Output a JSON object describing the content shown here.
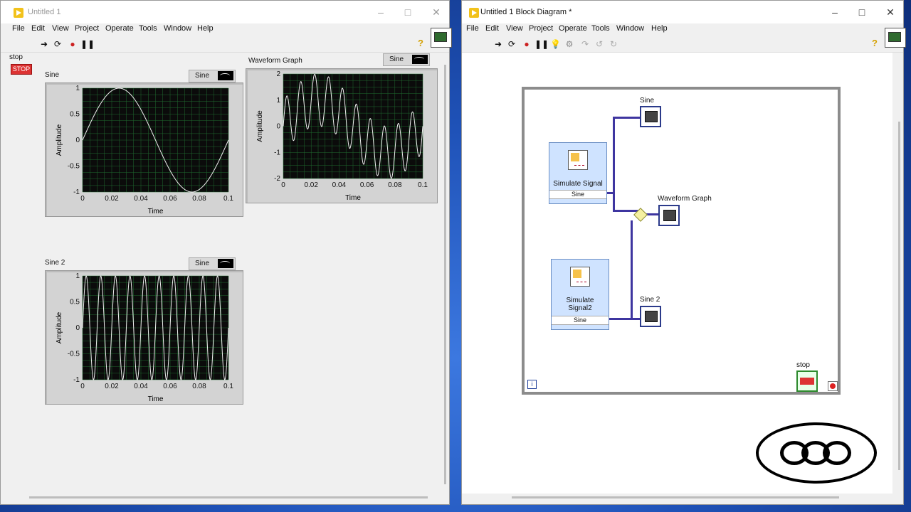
{
  "front_panel": {
    "title": "Untitled 1",
    "menu": [
      "File",
      "Edit",
      "View",
      "Project",
      "Operate",
      "Tools",
      "Window",
      "Help"
    ],
    "stop_label": "stop",
    "stop_button": "STOP",
    "controls": [
      "minimize",
      "maximize",
      "close"
    ]
  },
  "block_diagram": {
    "title": "Untitled 1 Block Diagram *",
    "menu": [
      "File",
      "Edit",
      "View",
      "Project",
      "Operate",
      "Tools",
      "Window",
      "Help"
    ],
    "sim1_title": "Simulate Signal",
    "sim1_port": "Sine",
    "sim2_title": "Simulate Signal2",
    "sim2_port": "Sine",
    "sine_label": "Sine",
    "wg_label": "Waveform Graph",
    "sine2_label": "Sine 2",
    "stop_label": "stop",
    "loop_iter": "i"
  },
  "chart_data": [
    {
      "type": "line",
      "title": "Sine",
      "legend": "Sine",
      "xlabel": "Time",
      "ylabel": "Amplitude",
      "xlim": [
        0,
        0.1
      ],
      "ylim": [
        -1,
        1
      ],
      "xticks": [
        "0",
        "0.02",
        "0.04",
        "0.06",
        "0.08",
        "0.1"
      ],
      "yticks": [
        "1",
        "0.5",
        "0",
        "-0.5",
        "-1"
      ],
      "series": [
        {
          "name": "Sine",
          "freq_hz": 10,
          "amplitude": 1
        }
      ]
    },
    {
      "type": "line",
      "title": "Waveform Graph",
      "legend": "Sine",
      "xlabel": "Time",
      "ylabel": "Amplitude",
      "xlim": [
        0,
        0.1
      ],
      "ylim": [
        -2,
        2
      ],
      "xticks": [
        "0",
        "0.02",
        "0.04",
        "0.06",
        "0.08",
        "0.1"
      ],
      "yticks": [
        "2",
        "1",
        "0",
        "-1",
        "-2"
      ],
      "series": [
        {
          "name": "Sine",
          "freq_hz": [
            10,
            100
          ],
          "amplitude": [
            1,
            1
          ]
        }
      ]
    },
    {
      "type": "line",
      "title": "Sine 2",
      "legend": "Sine",
      "xlabel": "Time",
      "ylabel": "Amplitude",
      "xlim": [
        0,
        0.1
      ],
      "ylim": [
        -1,
        1
      ],
      "xticks": [
        "0",
        "0.02",
        "0.04",
        "0.06",
        "0.08",
        "0.1"
      ],
      "yticks": [
        "1",
        "0.5",
        "0",
        "-0.5",
        "-1"
      ],
      "series": [
        {
          "name": "Sine",
          "freq_hz": 100,
          "amplitude": 1
        }
      ]
    }
  ],
  "colors": {
    "plot_bg": "#0b0b0b",
    "grid": "#1f6a2f",
    "trace": "#f0f0f0",
    "wire": "#3e35a0"
  }
}
